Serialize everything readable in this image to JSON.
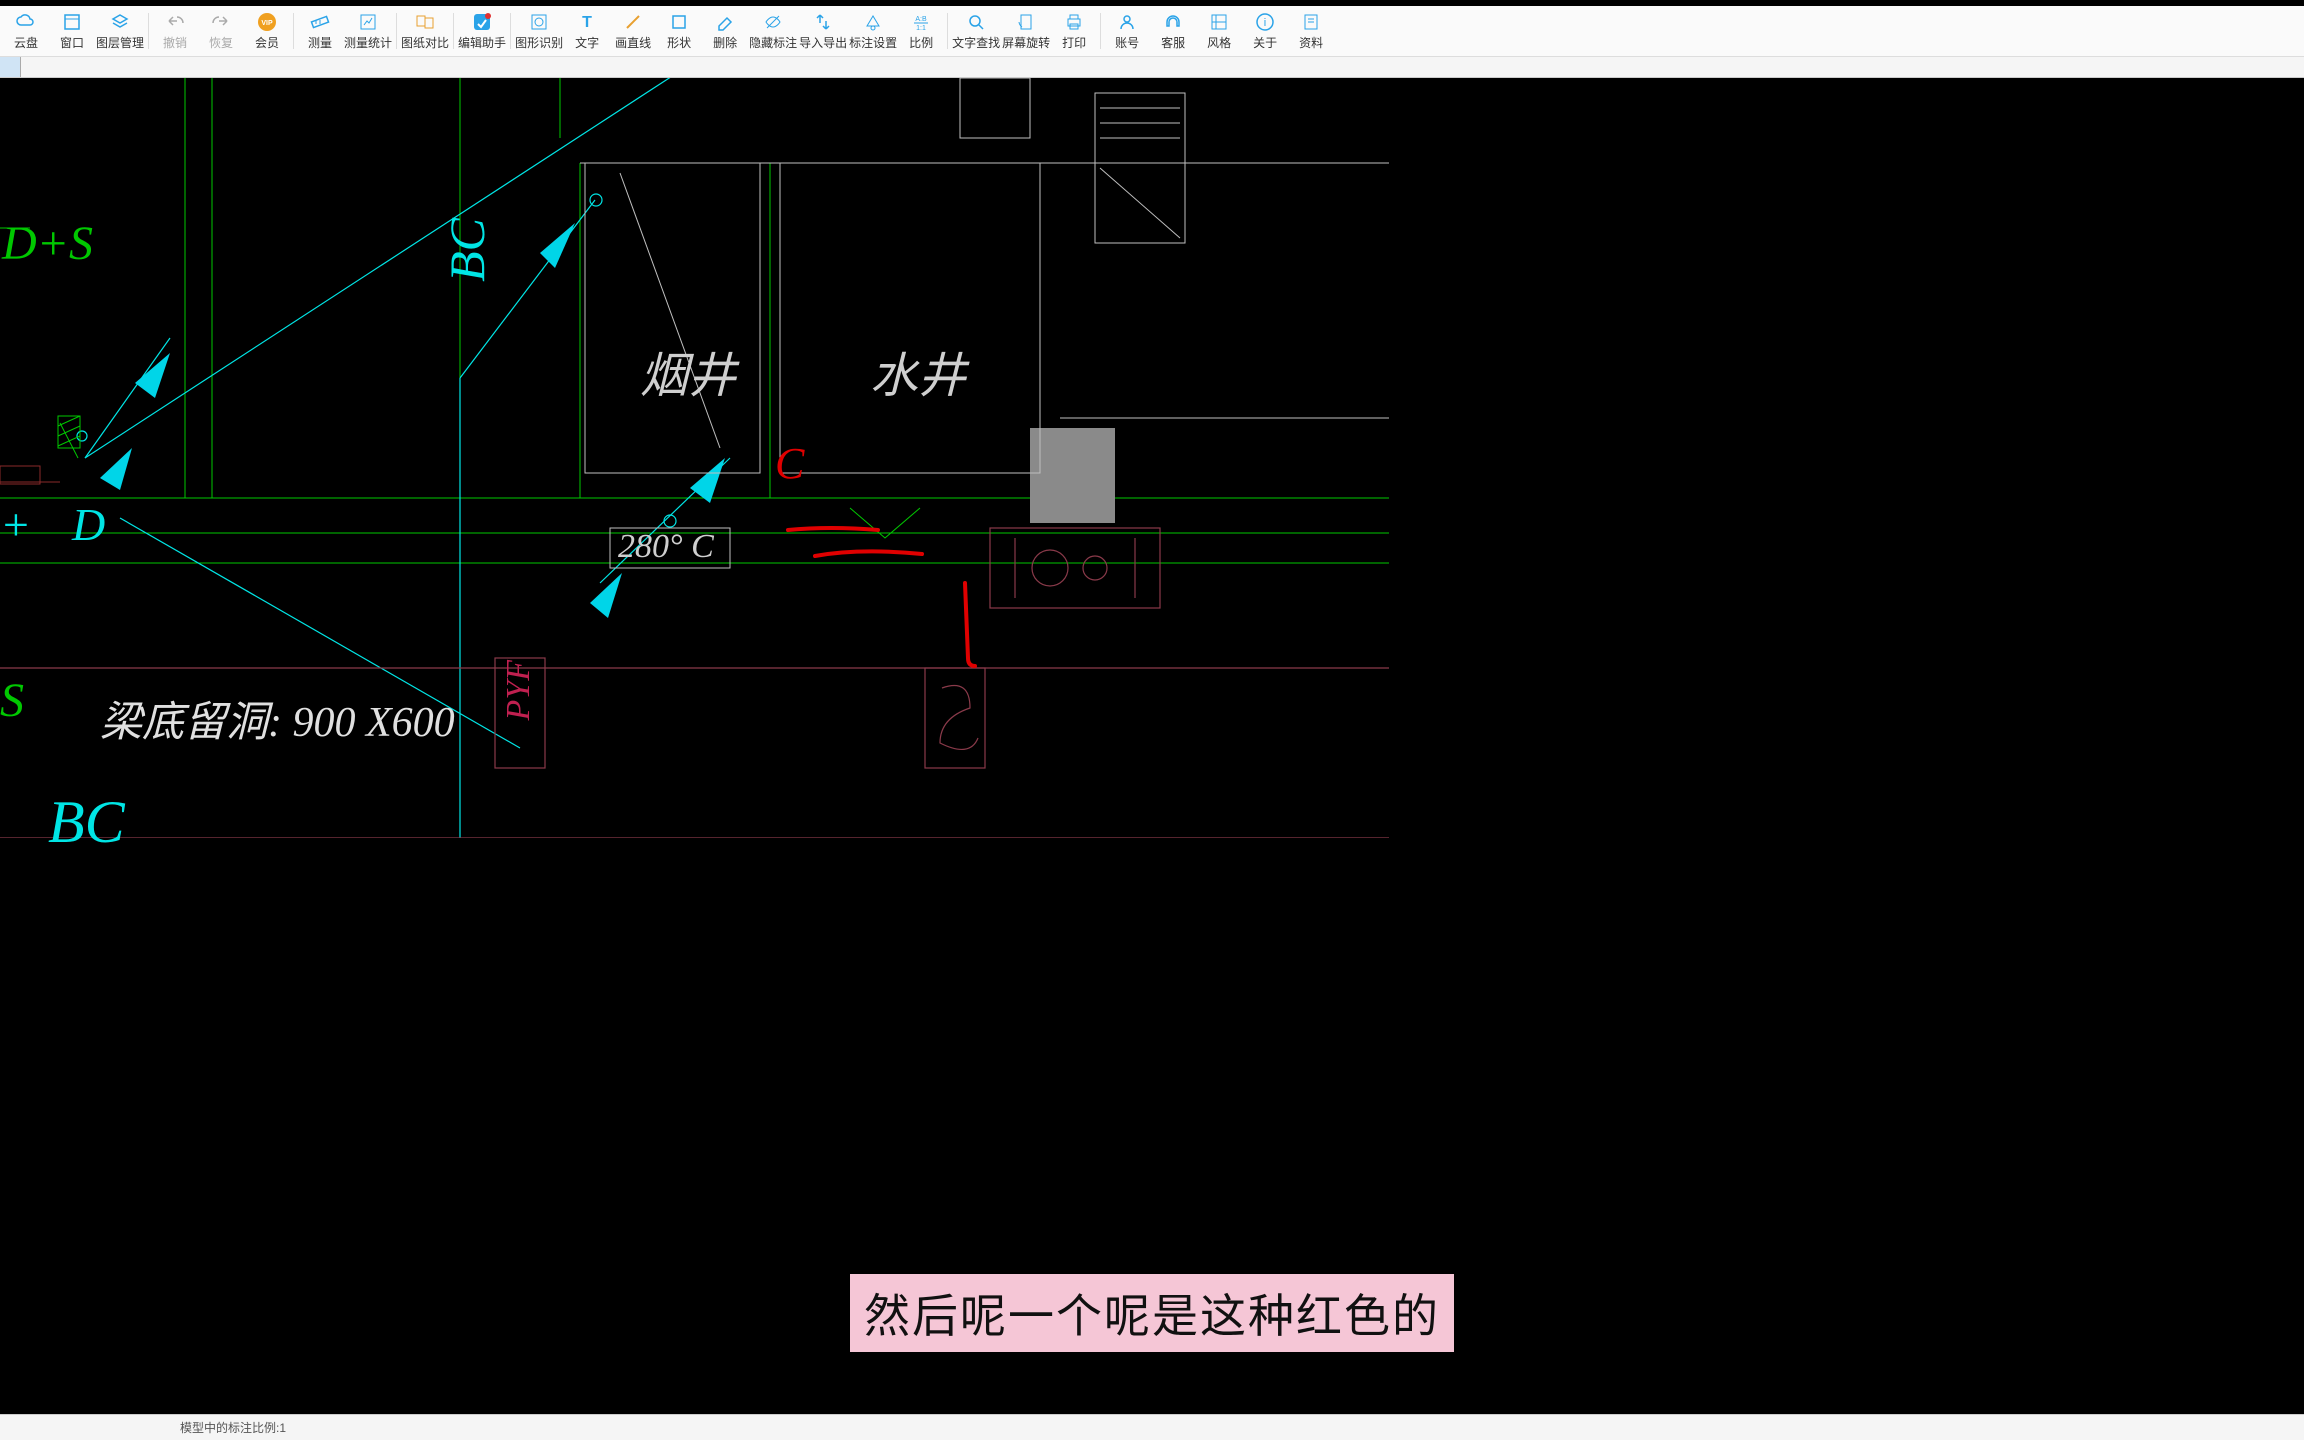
{
  "toolbar": [
    {
      "id": "cloud",
      "label": "云盘",
      "color": "#2aa3e8"
    },
    {
      "id": "window",
      "label": "窗口",
      "color": "#2aa3e8"
    },
    {
      "id": "layer",
      "label": "图层管理",
      "color": "#2aa3e8"
    },
    {
      "id": "sep"
    },
    {
      "id": "undo",
      "label": "撤销",
      "color": "#aaa",
      "disabled": true
    },
    {
      "id": "redo",
      "label": "恢复",
      "color": "#aaa",
      "disabled": true
    },
    {
      "id": "vip",
      "label": "会员",
      "color": "#f0a020",
      "vip": true
    },
    {
      "id": "sep"
    },
    {
      "id": "measure",
      "label": "测量",
      "color": "#2aa3e8"
    },
    {
      "id": "measure-stat",
      "label": "测量统计",
      "color": "#2aa3e8"
    },
    {
      "id": "sep"
    },
    {
      "id": "compare",
      "label": "图纸对比",
      "color": "#e8a030"
    },
    {
      "id": "sep"
    },
    {
      "id": "edit-helper",
      "label": "编辑助手",
      "color": "#2aa3e8",
      "badge": true
    },
    {
      "id": "sep"
    },
    {
      "id": "shape-rec",
      "label": "图形识别",
      "color": "#2aa3e8"
    },
    {
      "id": "text",
      "label": "文字",
      "color": "#2aa3e8"
    },
    {
      "id": "line",
      "label": "画直线",
      "color": "#e8a030"
    },
    {
      "id": "shape",
      "label": "形状",
      "color": "#2aa3e8"
    },
    {
      "id": "erase",
      "label": "删除",
      "color": "#2aa3e8"
    },
    {
      "id": "hide-anno",
      "label": "隐藏标注",
      "color": "#2aa3e8"
    },
    {
      "id": "import-export",
      "label": "导入导出",
      "color": "#2aa3e8"
    },
    {
      "id": "anno-set",
      "label": "标注设置",
      "color": "#2aa3e8"
    },
    {
      "id": "scale",
      "label": "比例",
      "color": "#2aa3e8"
    },
    {
      "id": "sep"
    },
    {
      "id": "find-text",
      "label": "文字查找",
      "color": "#2aa3e8"
    },
    {
      "id": "rotate",
      "label": "屏幕旋转",
      "color": "#2aa3e8"
    },
    {
      "id": "print",
      "label": "打印",
      "color": "#2aa3e8"
    },
    {
      "id": "sep"
    },
    {
      "id": "account",
      "label": "账号",
      "color": "#2aa3e8"
    },
    {
      "id": "support",
      "label": "客服",
      "color": "#2aa3e8"
    },
    {
      "id": "style",
      "label": "风格",
      "color": "#2aa3e8"
    },
    {
      "id": "about",
      "label": "关于",
      "color": "#2aa3e8"
    },
    {
      "id": "docs",
      "label": "资料",
      "color": "#2aa3e8"
    }
  ],
  "tab_blank": " ",
  "drawing": {
    "texts": {
      "ds": "D+S",
      "bc_vert": "BC",
      "yanjing": "烟井",
      "shuijing": "水井",
      "temp": "280°  C",
      "pyf": "PYF",
      "liang": "梁底留洞: 900  X600",
      "bc_bottom": "BC",
      "d_left": "D",
      "c_red": "C",
      "s_left": "S",
      "plus": "+"
    }
  },
  "subtitle": "然后呢一个呢是这种红色的",
  "status": "模型中的标注比例:1"
}
